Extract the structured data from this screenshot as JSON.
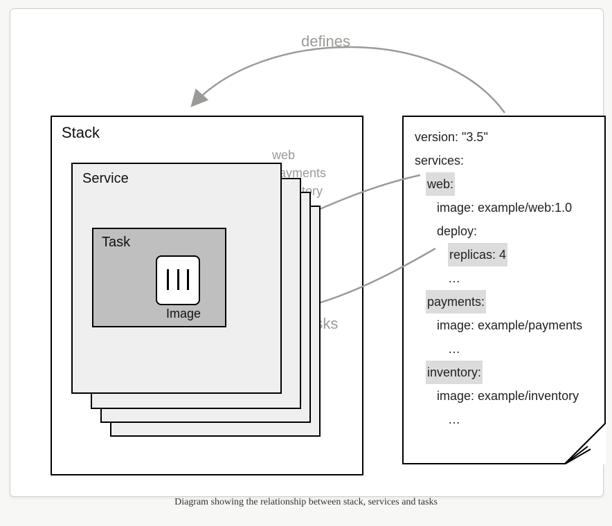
{
  "caption": "Diagram showing the relationship between stack, services and tasks",
  "labels": {
    "stack": "Stack",
    "service": "Service",
    "task": "Task",
    "image": "Image",
    "defines": "defines",
    "tasks": "tasks"
  },
  "service_tags": {
    "a": "web",
    "b": "payments",
    "c": "inventory"
  },
  "yaml": {
    "l01": "version: \"3.5\"",
    "l02": "services:",
    "l03": "web:",
    "l04": "image: example/web:1.0",
    "l05": "deploy:",
    "l06": "replicas: 4",
    "l07": "…",
    "l08": "payments:",
    "l09": "image: example/payments",
    "l10": "…",
    "l11": "inventory:",
    "l12": "image: example/inventory",
    "l13": "…"
  }
}
